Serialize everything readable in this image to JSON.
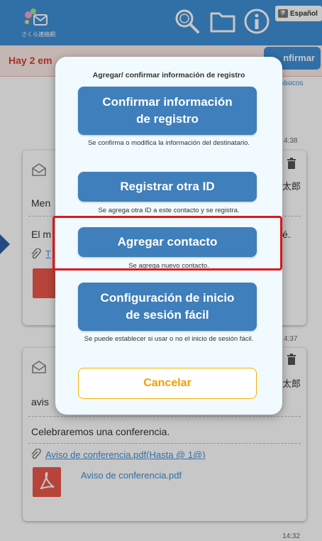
{
  "header": {
    "logo_text": "さくら連絡網",
    "language_label": "Español",
    "language_flag": "字"
  },
  "background": {
    "notice_text": "Hay 2 em",
    "confirm_button": "nfirmar",
    "basics_link": "les básicos",
    "messages": [
      {
        "time": "4:38",
        "sender": "太郎",
        "subject": "Men",
        "body": "El m",
        "body_tail": "é.",
        "attachment_hint": "T"
      },
      {
        "time": "4:37",
        "sender": "太郎",
        "subject": "avis",
        "body": "Celebraremos una conferencia.",
        "attachment_link": "Aviso de conferencia.pdf",
        "attachment_extra": "(Hasta @ 1@)",
        "attachment_file": "Aviso de conferencia.pdf"
      }
    ],
    "last_time": "14:32"
  },
  "dialog": {
    "title": "Agregar/ confirmar información de registro",
    "options": [
      {
        "label": "Confirmar información de registro",
        "description": "Se confirma o modifica la información del destinatario."
      },
      {
        "label": "Registrar otra ID",
        "description": "Se agrega otra ID a este contacto y se registra."
      },
      {
        "label": "Agregar contacto",
        "description": "Se agrega nuevo contacto."
      },
      {
        "label": "Configuración de inicio de sesión fácil",
        "description": "Se puede establecer si usar o no el inicio de sesión fácil."
      }
    ],
    "cancel_label": "Cancelar"
  },
  "colors": {
    "header_blue": "#3f8fd6",
    "option_blue": "#3f7fbb",
    "cancel_border": "#f0b400",
    "highlight_red": "#e0161a",
    "notice_red": "#d3432d"
  },
  "icons": [
    "logo-icon",
    "search-icon",
    "folder-icon",
    "info-icon",
    "envelope-icon",
    "trash-icon",
    "paperclip-icon",
    "pdf-icon",
    "arrow-left-icon"
  ]
}
